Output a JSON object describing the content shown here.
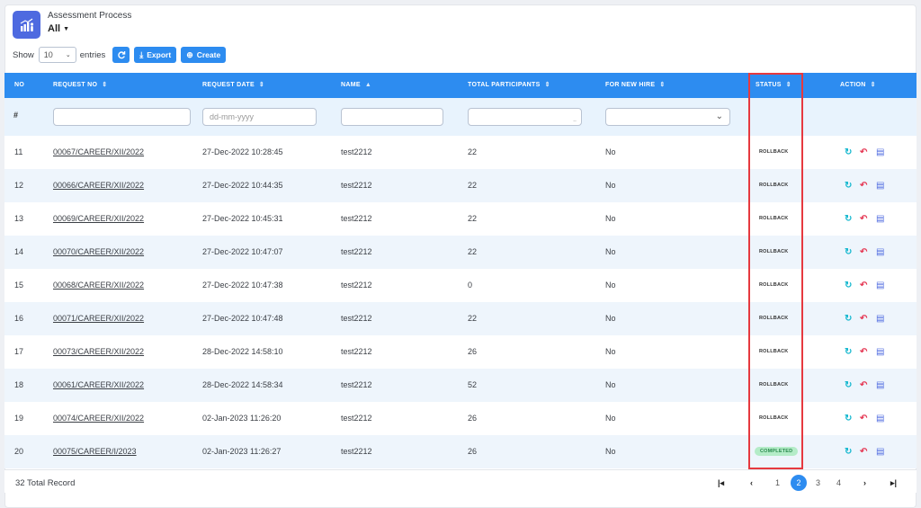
{
  "header": {
    "title": "Assessment Process",
    "filter_label": "All",
    "caret_icon": "caret-down-icon",
    "app_icon": "chart-person-icon"
  },
  "controls": {
    "show_label": "Show",
    "entries_value": "10",
    "entries_label": "entries",
    "refresh_icon": "refresh-icon",
    "export_label": "Export",
    "create_label": "Create"
  },
  "table": {
    "columns": [
      {
        "label": "NO"
      },
      {
        "label": "REQUEST NO"
      },
      {
        "label": "REQUEST DATE"
      },
      {
        "label": "NAME"
      },
      {
        "label": "TOTAL PARTICIPANTS"
      },
      {
        "label": "FOR NEW HIRE"
      },
      {
        "label": "STATUS"
      },
      {
        "label": "ACTION"
      }
    ],
    "filters": {
      "hash": "#",
      "date_placeholder": "dd-mm-yyyy"
    },
    "rows": [
      {
        "no": "11",
        "request_no": "00067/CAREER/XII/2022",
        "request_date": "27-Dec-2022 10:28:45",
        "name": "test2212",
        "participants": "22",
        "new_hire": "No",
        "status": "ROLLBACK"
      },
      {
        "no": "12",
        "request_no": "00066/CAREER/XII/2022",
        "request_date": "27-Dec-2022 10:44:35",
        "name": "test2212",
        "participants": "22",
        "new_hire": "No",
        "status": "ROLLBACK"
      },
      {
        "no": "13",
        "request_no": "00069/CAREER/XII/2022",
        "request_date": "27-Dec-2022 10:45:31",
        "name": "test2212",
        "participants": "22",
        "new_hire": "No",
        "status": "ROLLBACK"
      },
      {
        "no": "14",
        "request_no": "00070/CAREER/XII/2022",
        "request_date": "27-Dec-2022 10:47:07",
        "name": "test2212",
        "participants": "22",
        "new_hire": "No",
        "status": "ROLLBACK"
      },
      {
        "no": "15",
        "request_no": "00068/CAREER/XII/2022",
        "request_date": "27-Dec-2022 10:47:38",
        "name": "test2212",
        "participants": "0",
        "new_hire": "No",
        "status": "ROLLBACK"
      },
      {
        "no": "16",
        "request_no": "00071/CAREER/XII/2022",
        "request_date": "27-Dec-2022 10:47:48",
        "name": "test2212",
        "participants": "22",
        "new_hire": "No",
        "status": "ROLLBACK"
      },
      {
        "no": "17",
        "request_no": "00073/CAREER/XII/2022",
        "request_date": "28-Dec-2022 14:58:10",
        "name": "test2212",
        "participants": "26",
        "new_hire": "No",
        "status": "ROLLBACK"
      },
      {
        "no": "18",
        "request_no": "00061/CAREER/XII/2022",
        "request_date": "28-Dec-2022 14:58:34",
        "name": "test2212",
        "participants": "52",
        "new_hire": "No",
        "status": "ROLLBACK"
      },
      {
        "no": "19",
        "request_no": "00074/CAREER/XII/2022",
        "request_date": "02-Jan-2023 11:26:20",
        "name": "test2212",
        "participants": "26",
        "new_hire": "No",
        "status": "ROLLBACK"
      },
      {
        "no": "20",
        "request_no": "00075/CAREER/I/2023",
        "request_date": "02-Jan-2023 11:26:27",
        "name": "test2212",
        "participants": "26",
        "new_hire": "No",
        "status": "COMPLETED"
      }
    ]
  },
  "footer": {
    "total_label": "32 Total Record",
    "pages": [
      "1",
      "2",
      "3",
      "4"
    ],
    "active_page": "2"
  },
  "colors": {
    "accent": "#2d8cf0",
    "highlight": "#e6393f",
    "completed_bg": "#b4ecc8"
  }
}
